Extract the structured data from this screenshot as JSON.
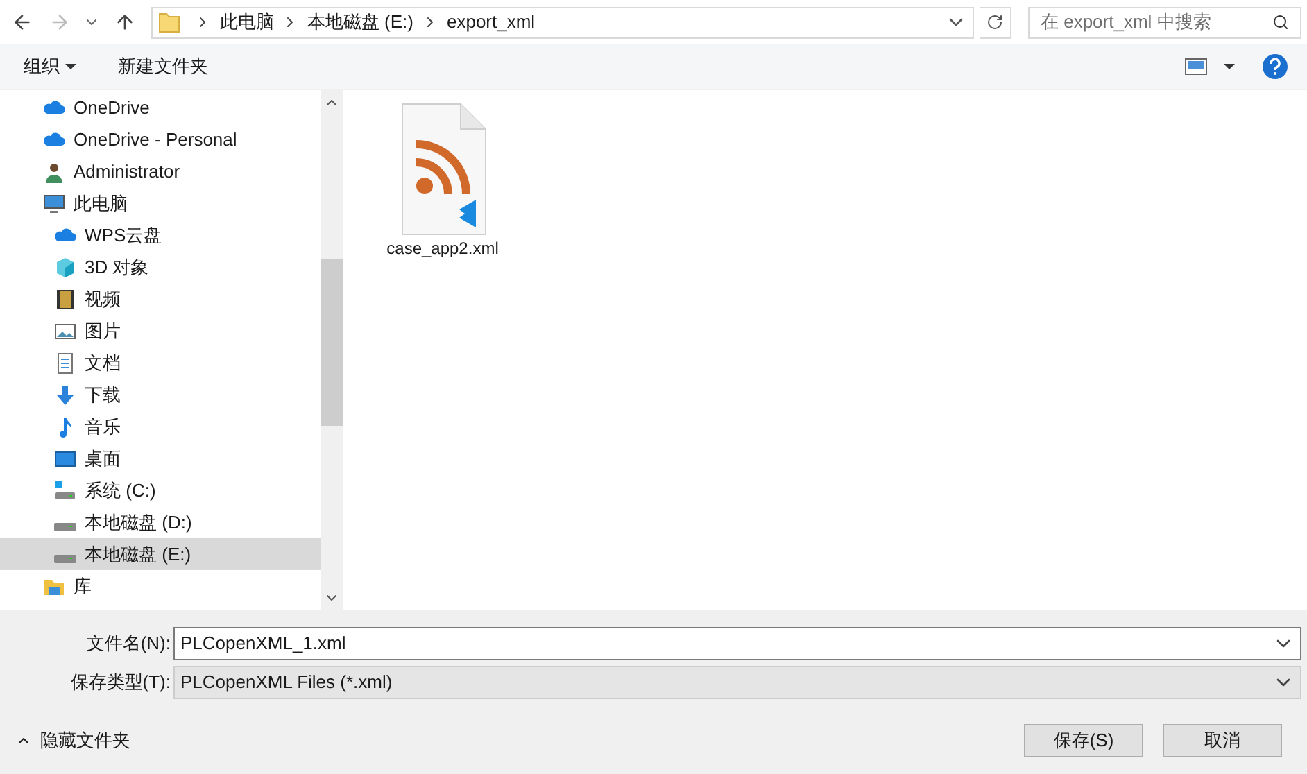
{
  "address_bar": {
    "path": [
      "此电脑",
      "本地磁盘 (E:)",
      "export_xml"
    ]
  },
  "search": {
    "placeholder": "在 export_xml 中搜索"
  },
  "toolbar": {
    "organize": "组织",
    "new_folder": "新建文件夹"
  },
  "sidebar": {
    "items": [
      {
        "label": "OneDrive",
        "kind": "cloud",
        "selected": false
      },
      {
        "label": "OneDrive - Personal",
        "kind": "cloud",
        "selected": false
      },
      {
        "label": "Administrator",
        "kind": "user",
        "selected": false
      },
      {
        "label": "此电脑",
        "kind": "pc",
        "selected": false,
        "children": [
          {
            "label": "WPS云盘",
            "kind": "cloud",
            "selected": false
          },
          {
            "label": "3D 对象",
            "kind": "cube",
            "selected": false
          },
          {
            "label": "视频",
            "kind": "video",
            "selected": false
          },
          {
            "label": "图片",
            "kind": "image",
            "selected": false
          },
          {
            "label": "文档",
            "kind": "doc",
            "selected": false
          },
          {
            "label": "下载",
            "kind": "download",
            "selected": false
          },
          {
            "label": "音乐",
            "kind": "music",
            "selected": false
          },
          {
            "label": "桌面",
            "kind": "desktop",
            "selected": false
          },
          {
            "label": "系统 (C:)",
            "kind": "sysdrive",
            "selected": false
          },
          {
            "label": "本地磁盘 (D:)",
            "kind": "drive",
            "selected": false
          },
          {
            "label": "本地磁盘 (E:)",
            "kind": "drive",
            "selected": true
          }
        ]
      },
      {
        "label": "库",
        "kind": "folder",
        "selected": false
      }
    ]
  },
  "files": [
    {
      "name": "case_app2.xml",
      "kind": "xml"
    }
  ],
  "filename": {
    "label": "文件名(N):",
    "value": "PLCopenXML_1.xml"
  },
  "filetype": {
    "label": "保存类型(T):",
    "value": "PLCopenXML Files (*.xml)"
  },
  "hide_folders": "隐藏文件夹",
  "buttons": [
    "保存(S)",
    "取消"
  ]
}
